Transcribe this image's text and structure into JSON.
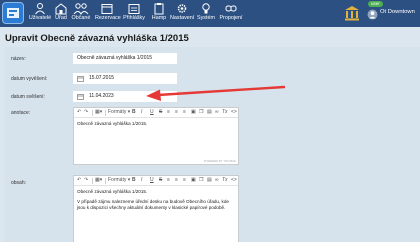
{
  "nav": {
    "items": [
      {
        "label": "Uživatelé",
        "icon": "users-icon"
      },
      {
        "label": "Úřad",
        "icon": "building-icon"
      },
      {
        "label": "Občané",
        "icon": "citizens-icon"
      },
      {
        "label": "Rezervace",
        "icon": "calendar-icon"
      },
      {
        "label": "Přihlášky",
        "icon": "calendar-list-icon"
      },
      {
        "label": "Hamp",
        "icon": "clipboard-icon"
      },
      {
        "label": "Nastavení",
        "icon": "gear-icon"
      },
      {
        "label": "Systém",
        "icon": "lightbulb-icon"
      },
      {
        "label": "Propojení",
        "icon": "link-icon"
      }
    ],
    "badge": "user",
    "user_name": "Ot Downtown"
  },
  "page": {
    "title": "Upravit Obecně závazná vyhláška 1/2015"
  },
  "form": {
    "nazev_label": "název:",
    "nazev_value": "Obecně závazná vyhláška 1/2015",
    "vyveseni_label": "datum vyvěšení:",
    "vyveseni_value": "15.07.2015",
    "sveseni_label": "datum svěšení:",
    "sveseni_value": "11.04.2023",
    "anotace_label": "anotace:",
    "anotace_text": "Obecně závazná vyhláška 1/2015.",
    "obsah_label": "obsah:",
    "obsah_text_1": "Obecně závazná vyhláška 1/2015.",
    "obsah_text_2": "V případě zájmu nalezneme úřední desku na budově Obecního úřadu, kde jsou k dispozici všechny aktuální dokumenty v klasické papírové podobě.",
    "powered": "POWERED BY TINYMCE"
  },
  "toolbar": {
    "formats": "Formáty",
    "bold": "B",
    "italic": "I",
    "underline": "U",
    "strike": "S",
    "clear": "Tx"
  },
  "colors": {
    "topbar": "#2c5082",
    "background": "#dce6ee",
    "arrow": "#e53935"
  }
}
